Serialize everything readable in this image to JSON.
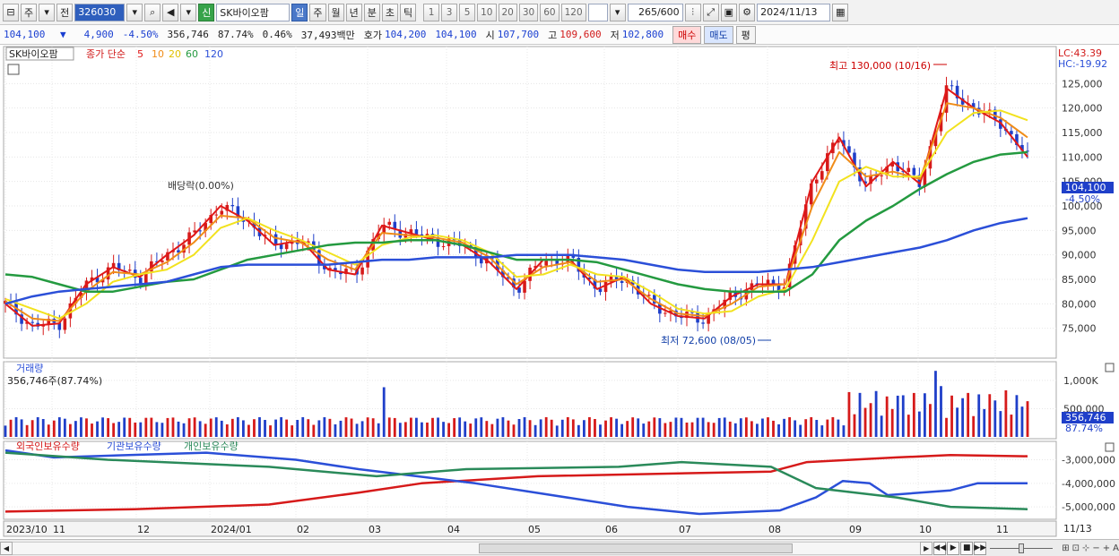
{
  "toolbar": {
    "market": "주",
    "prefix": "전",
    "code": "326030",
    "stock_name": "SK바이오팜",
    "shin_label": "신",
    "periods": [
      "일",
      "주",
      "월",
      "년",
      "분",
      "초",
      "틱"
    ],
    "active_period": "일",
    "minute_options": [
      "1",
      "3",
      "5",
      "10",
      "20",
      "30",
      "60",
      "120"
    ],
    "count": "265",
    "count_max": "/600",
    "date": "2024/11/13"
  },
  "quote": {
    "price": "104,100",
    "direction_icon": "▼",
    "change": "4,900",
    "change_pct": "-4.50%",
    "volume": "356,746",
    "vol_ratio": "87.74%",
    "turnover": "0.46%",
    "amount": "37,493백만",
    "hoga_label": "호가",
    "ask": "104,200",
    "bid": "104,100",
    "open_label": "시",
    "open": "107,700",
    "high_label": "고",
    "high": "109,600",
    "low_label": "저",
    "low": "102,800",
    "buy_label": "매수",
    "sell_label": "매도",
    "flat_label": "평"
  },
  "price_panel": {
    "name_tag": "SK바이오팜",
    "ma_label": "종가 단순",
    "ma_periods": [
      "5",
      "10",
      "20",
      "60",
      "120"
    ],
    "ma_colors": [
      "#e01818",
      "#f08c18",
      "#f2e21e",
      "#249a40",
      "#2b4fd8"
    ],
    "lc": "LC:43.39",
    "hc": "HC:-19.92",
    "y_ticks": [
      "125,000",
      "120,000",
      "115,000",
      "110,000",
      "105,000",
      "100,000",
      "95,000",
      "90,000",
      "85,000",
      "80,000",
      "75,000"
    ],
    "current_price_tag": "104,100",
    "current_pct_tag": "-4.50%",
    "max_note": "최고 130,000 (10/16)",
    "min_note": "최저 72,600 (08/05)",
    "dividend_note": "배당락(0.00%)"
  },
  "volume_panel": {
    "title": "거래량",
    "subtitle": "356,746주(87.74%)",
    "y_ticks": [
      "1,000K",
      "500,000"
    ],
    "tag_volume": "356,746",
    "tag_pct": "87.74%"
  },
  "holding_panel": {
    "series": [
      "외국인보유수량",
      "기관보유수량",
      "개인보유수량"
    ],
    "colors": [
      "#d61a1a",
      "#2b4fd8",
      "#2a8a5a"
    ],
    "y_ticks": [
      "-3,000,000",
      "-4,000,000",
      "-5,000,000"
    ]
  },
  "x_axis": {
    "labels": [
      "2023/10",
      "11",
      "12",
      "2024/01",
      "02",
      "03",
      "04",
      "05",
      "06",
      "07",
      "08",
      "09",
      "10",
      "11"
    ],
    "right_label": "11/13"
  },
  "chart_data": {
    "type": "candlestick",
    "title": "SK바이오팜",
    "ylim": [
      70000,
      130000
    ],
    "high": {
      "value": 130000,
      "date": "10/16"
    },
    "low": {
      "value": 72600,
      "date": "08/05"
    },
    "last_close": 104100,
    "ma_series": [
      {
        "name": "5",
        "values": [
          80000,
          75500,
          76000,
          84000,
          87500,
          85500,
          90000,
          94000,
          100000,
          97000,
          92000,
          93000,
          87000,
          86000,
          96000,
          94500,
          93000,
          92000,
          88500,
          83000,
          89000,
          89000,
          83000,
          85500,
          80000,
          77500,
          77000,
          81500,
          84000,
          84000,
          105000,
          114000,
          104000,
          109000,
          104500,
          124000,
          120000,
          117000,
          110000
        ]
      },
      {
        "name": "10",
        "values": [
          80500,
          77000,
          76500,
          82500,
          86500,
          86000,
          88500,
          92500,
          98000,
          97500,
          93500,
          92500,
          89000,
          87000,
          94500,
          94000,
          93500,
          92500,
          89500,
          84000,
          87500,
          88500,
          84500,
          85000,
          81000,
          78000,
          77500,
          80000,
          83500,
          84000,
          100000,
          111000,
          106000,
          107000,
          105500,
          121000,
          120000,
          118000,
          114000
        ]
      },
      {
        "name": "20",
        "values": [
          81000,
          79000,
          77000,
          80000,
          84500,
          86000,
          87000,
          90000,
          95500,
          97500,
          95000,
          93000,
          90500,
          88000,
          92000,
          93500,
          94000,
          93000,
          90500,
          85500,
          86000,
          88000,
          86000,
          85500,
          82500,
          79000,
          78000,
          78500,
          81500,
          83000,
          93000,
          105000,
          108000,
          106000,
          106000,
          115000,
          119000,
          119500,
          117500
        ]
      },
      {
        "name": "60",
        "values": [
          86000,
          85500,
          84000,
          82500,
          82500,
          83500,
          84500,
          85000,
          87000,
          89000,
          90000,
          91000,
          92000,
          92500,
          92500,
          93000,
          93000,
          92000,
          90500,
          89000,
          89000,
          89000,
          88500,
          87000,
          85500,
          84000,
          83000,
          82500,
          82500,
          82500,
          86000,
          93000,
          97000,
          100000,
          103500,
          106500,
          109000,
          110500,
          111000
        ]
      },
      {
        "name": "120",
        "values": [
          80000,
          81500,
          82500,
          83000,
          83500,
          84000,
          84500,
          86000,
          87500,
          88000,
          88000,
          88000,
          88000,
          88500,
          89000,
          89000,
          89500,
          89500,
          89500,
          90000,
          90000,
          90000,
          89500,
          89000,
          88000,
          87000,
          86500,
          86500,
          86500,
          87000,
          87500,
          88500,
          89500,
          90500,
          91500,
          93000,
          95000,
          96500,
          97500
        ]
      }
    ]
  }
}
